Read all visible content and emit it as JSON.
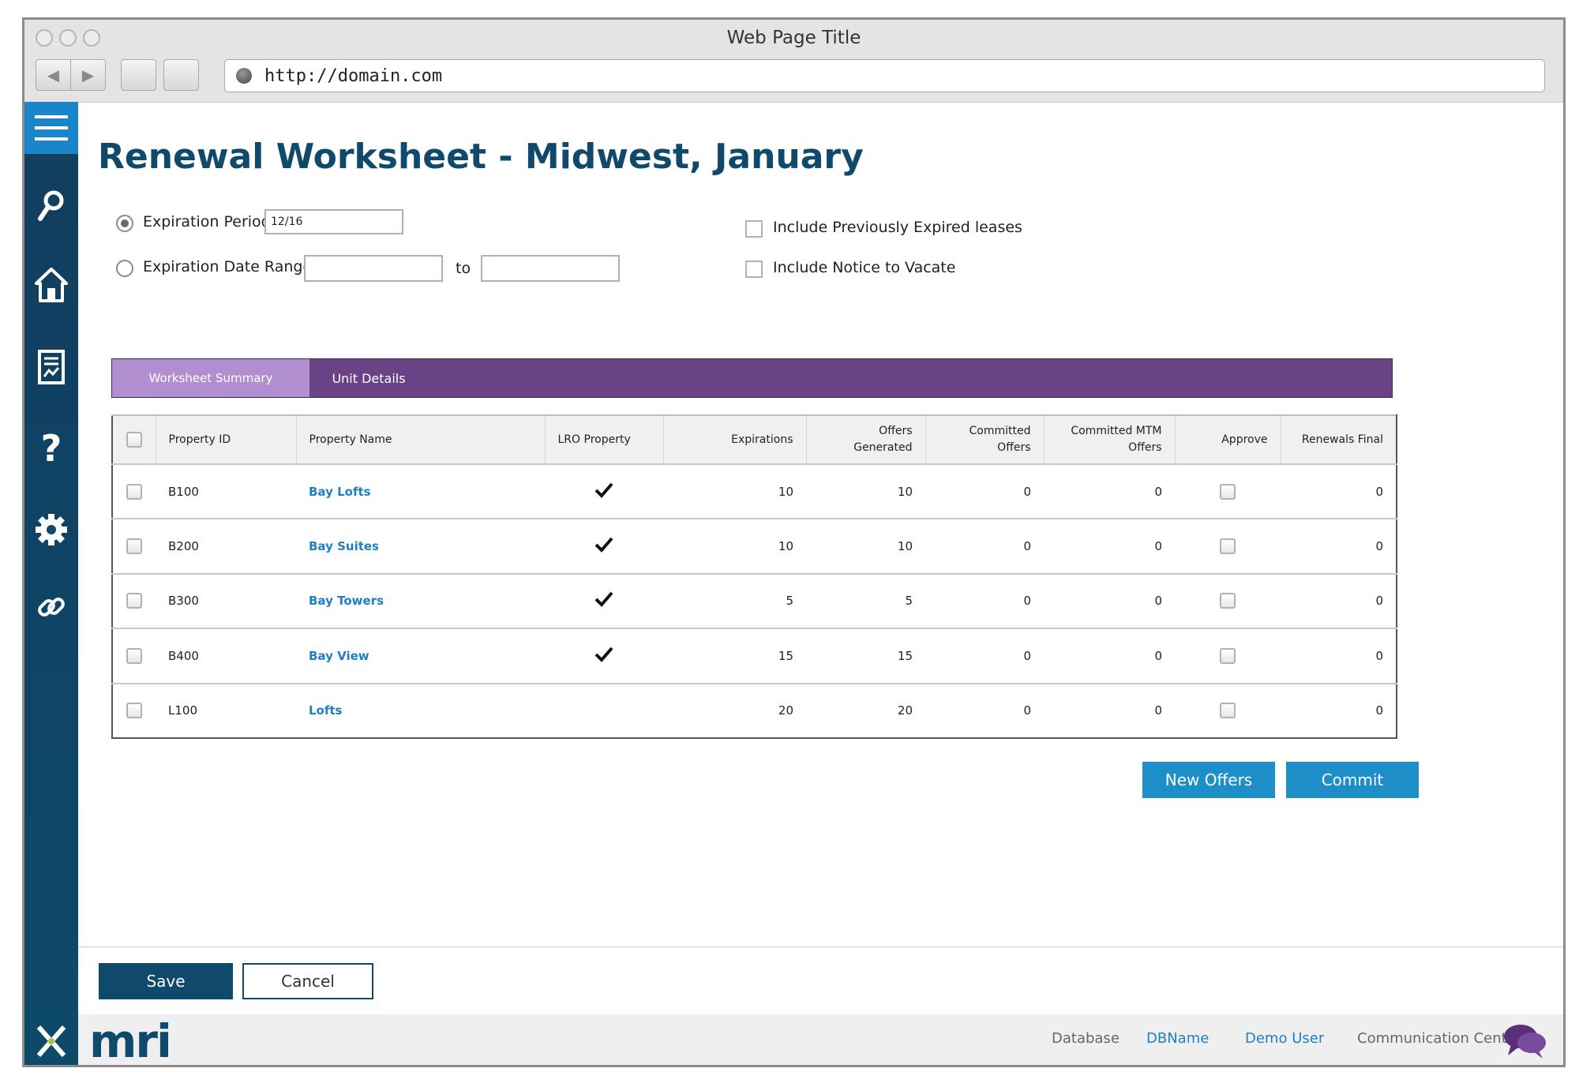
{
  "window": {
    "title": "Web Page Title",
    "url": "http://domain.com"
  },
  "page": {
    "title": "Renewal Worksheet - Midwest, January"
  },
  "filters": {
    "expiration_period_label": "Expiration Period",
    "expiration_period_value": "12/16",
    "expiration_date_range_label": "Expiration Date Range",
    "range_from_value": "",
    "range_to_label": "to",
    "range_to_value": "",
    "include_expired_label": "Include Previously Expired leases",
    "include_notice_label": "Include Notice to Vacate"
  },
  "tabs": [
    {
      "label": "Worksheet Summary",
      "active": true
    },
    {
      "label": "Unit Details",
      "active": false
    }
  ],
  "table": {
    "columns": {
      "property_id": "Property ID",
      "property_name": "Property Name",
      "lro_property": "LRO Property",
      "expirations": "Expirations",
      "offers_generated_1": "Offers",
      "offers_generated_2": "Generated",
      "committed_offers_1": "Committed",
      "committed_offers_2": "Offers",
      "committed_mtm_1": "Committed MTM",
      "committed_mtm_2": "Offers",
      "approve": "Approve",
      "renewals_final": "Renewals Final"
    },
    "rows": [
      {
        "id": "B100",
        "name": "Bay Lofts",
        "lro": true,
        "expirations": "10",
        "offers_generated": "10",
        "committed_offers": "0",
        "committed_mtm": "0",
        "renewals_final": "0"
      },
      {
        "id": "B200",
        "name": "Bay Suites",
        "lro": true,
        "expirations": "10",
        "offers_generated": "10",
        "committed_offers": "0",
        "committed_mtm": "0",
        "renewals_final": "0"
      },
      {
        "id": "B300",
        "name": "Bay Towers",
        "lro": true,
        "expirations": "5",
        "offers_generated": "5",
        "committed_offers": "0",
        "committed_mtm": "0",
        "renewals_final": "0"
      },
      {
        "id": "B400",
        "name": "Bay View",
        "lro": true,
        "expirations": "15",
        "offers_generated": "15",
        "committed_offers": "0",
        "committed_mtm": "0",
        "renewals_final": "0"
      },
      {
        "id": "L100",
        "name": "Lofts",
        "lro": false,
        "expirations": "20",
        "offers_generated": "20",
        "committed_offers": "0",
        "committed_mtm": "0",
        "renewals_final": "0"
      }
    ]
  },
  "actions": {
    "new_offers": "New Offers",
    "commit": "Commit",
    "save": "Save",
    "cancel": "Cancel"
  },
  "footer": {
    "brand": "mri",
    "database_label": "Database",
    "database_value": "DBName",
    "user": "Demo User",
    "communication_center": "Communication Center"
  },
  "sidebar": {
    "icons": [
      "menu-icon",
      "search-icon",
      "home-icon",
      "report-icon",
      "help-icon",
      "gear-icon",
      "link-icon"
    ]
  },
  "colors": {
    "brand_navy": "#0f4a6d",
    "accent_blue": "#1d8ec8",
    "tab_purple": "#6a4386",
    "tab_active": "#b18ed0",
    "link_blue": "#1e7fc2"
  }
}
